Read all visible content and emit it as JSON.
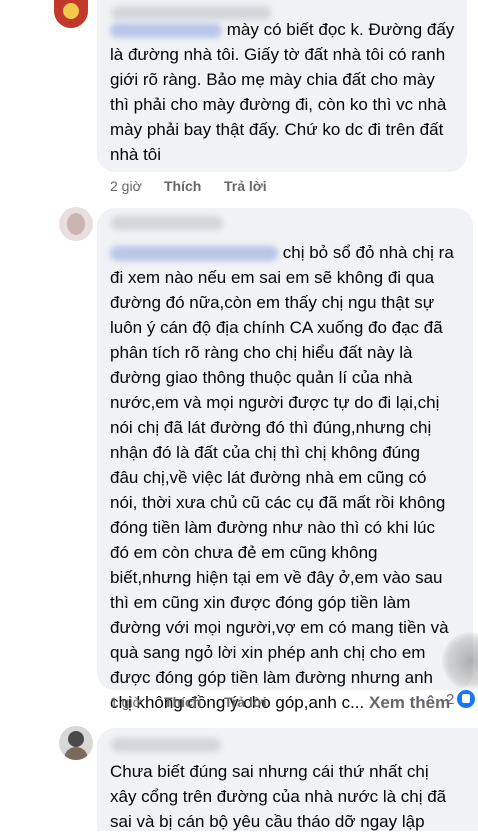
{
  "comments": [
    {
      "text_after_mention": "mày có biết đọc k. Đường đấy\nlà đường nhà tôi. Giấy tờ đất nhà tôi có ranh\ngiới rõ ràng. Bảo mẹ mày chia đất cho mày\nthì phải cho mày đường đi, còn ko thì vc nhà\nmày phải bay thật đấy. Chứ ko dc đi trên đất\nnhà tôi",
      "time": "2 giờ",
      "like_label": "Thích",
      "reply_label": "Trả lời"
    },
    {
      "text_after_mention": "chị bỏ sổ đỏ nhà chị ra",
      "text_body": "đi xem nào nếu em sai em sẽ không đi qua\nđường đó nữa,còn em thấy chị ngu thật sự\nluôn ý cán độ địa chính CA xuống đo đạc đã\nphân tích rõ ràng cho chị hiểu đất này là\nđường giao thông thuộc quản lí của nhà\nnước,em và mọi người được tự do đi lại,chị\nnói chị đã lát đường đó thì đúng,nhưng chị\nnhận đó là đất của chị thì chị không đúng\nđâu chị,về việc lát đường nhà em cũng có\nnói, thời xưa  chủ cũ các cụ đã mất rồi không\nđóng tiền làm đường như nào thì có khi lúc\nđó em còn chưa đẻ em cũng không\nbiết,nhưng hiện tại em về đây ở,em vào sau\nthì em cũng xin được đóng góp tiền làm\nđường với mọi người,vợ em có mang tiền và\nquà sang ngỏ lời xin phép anh chị cho em\nđược đóng góp tiền làm đường nhưng anh\nchị không đồng ý cho góp,anh c...",
      "see_more": "Xem thêm",
      "time": "1 giờ",
      "like_label": "Thích",
      "reply_label": "Trả lời",
      "reaction_count": "2"
    },
    {
      "text": "Chưa biết đúng sai nhưng cái thứ nhất chị\nxây cổng trên đường của nhà nước là chị đã\nsai và bị cán bộ yêu cầu tháo dỡ ngay lập"
    }
  ],
  "colors": {
    "bubble": "#f0f2f5",
    "meta": "#65676b",
    "like_blue": "#1877f2"
  }
}
